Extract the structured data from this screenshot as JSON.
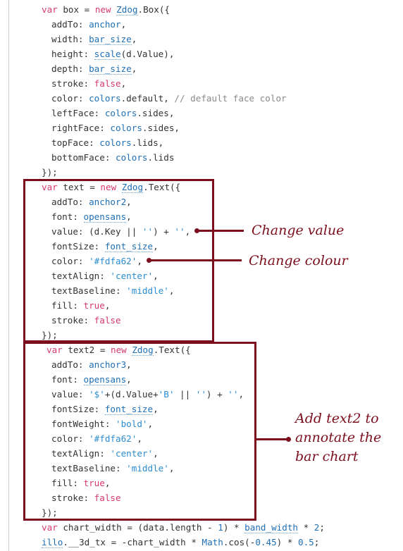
{
  "code": {
    "box_decl": {
      "kw_var": "var",
      "name": " box = ",
      "kw_new": "new",
      "sp": " ",
      "cls": "Zdog",
      "rest": ".Box({"
    },
    "box_props": [
      {
        "prop": "addTo: ",
        "val": "anchor",
        "tail": ","
      },
      {
        "prop": "width: ",
        "val": "bar_size",
        "tail": ","
      },
      {
        "prop": "height: ",
        "val": "scale",
        "mid": "(d.Value),"
      },
      {
        "prop": "depth: ",
        "val": "bar_size",
        "tail": ","
      },
      {
        "prop": "stroke: ",
        "val": "false",
        "tail": ","
      },
      {
        "prop": "color: ",
        "val": "colors",
        "mid": ".default, ",
        "comment": "// default face color"
      },
      {
        "prop": "leftFace: ",
        "val": "colors",
        "mid": ".sides,"
      },
      {
        "prop": "rightFace: ",
        "val": "colors",
        "mid": ".sides,"
      },
      {
        "prop": "topFace: ",
        "val": "colors",
        "mid": ".lids,"
      },
      {
        "prop": "bottomFace: ",
        "val": "colors",
        "mid": ".lids"
      }
    ],
    "close_1": "});",
    "text_decl": {
      "kw_var": "var",
      "name": " text = ",
      "kw_new": "new",
      "sp": " ",
      "cls": "Zdog",
      "rest": ".Text({"
    },
    "text_props": [
      {
        "prop": "addTo: ",
        "val": "anchor2",
        "tail": ","
      },
      {
        "prop": "font: ",
        "val": "opensans",
        "tail": ","
      },
      {
        "prop": "value: ",
        "a": "(d.Key || ",
        "s1": "''",
        "b": ") + ",
        "s2": "''",
        "c": ","
      },
      {
        "prop": "fontSize: ",
        "val": "font_size",
        "tail": ","
      },
      {
        "prop": "color: ",
        "str": "'#fdfa62'",
        "tail": ","
      },
      {
        "prop": "textAlign: ",
        "str": "'center'",
        "tail": ","
      },
      {
        "prop": "textBaseline: ",
        "str": "'middle'",
        "tail": ","
      },
      {
        "prop": "fill: ",
        "val": "true",
        "tail": ","
      },
      {
        "prop": "stroke: ",
        "val": "false",
        "tail": ""
      }
    ],
    "close_2": "});",
    "text2_decl": {
      "kw_var": "var",
      "name": " text2 = ",
      "kw_new": "new",
      "sp": " ",
      "cls": "Zdog",
      "rest": ".Text({"
    },
    "text2_props": [
      {
        "prop": "addTo: ",
        "val": "anchor3",
        "tail": ","
      },
      {
        "prop": "font: ",
        "val": "opensans",
        "tail": ","
      },
      {
        "prop": "value: ",
        "s0": "'$'",
        "a": "+(d.Value+",
        "s1": "'B'",
        "b": " || ",
        "s2": "''",
        "c": ") + ",
        "s3": "''",
        "d": ","
      },
      {
        "prop": "fontSize: ",
        "val": "font_size",
        "tail": ","
      },
      {
        "prop": "fontWeight: ",
        "str": "'bold'",
        "tail": ","
      },
      {
        "prop": "color: ",
        "str": "'#fdfa62'",
        "tail": ","
      },
      {
        "prop": "textAlign: ",
        "str": "'center'",
        "tail": ","
      },
      {
        "prop": "textBaseline: ",
        "str": "'middle'",
        "tail": ","
      },
      {
        "prop": "fill: ",
        "val": "true",
        "tail": ","
      },
      {
        "prop": "stroke: ",
        "val": "false",
        "tail": ""
      }
    ],
    "close_3": "});",
    "chart_width": {
      "kw_var": "var",
      "a": " chart_width = (data.length - ",
      "n1": "1",
      "b": ") * ",
      "ref": "band_width",
      "c": " * ",
      "n2": "2",
      "d": ";"
    },
    "illo": {
      "ref": "illo",
      "a": ".__3d_tx = -chart_width * ",
      "math": "Math",
      "b": ".cos(-",
      "n1": "0.45",
      "c": ") * ",
      "n2": "0.5",
      "d": ";"
    }
  },
  "annotations": {
    "change_value": "Change value",
    "change_colour": "Change colour",
    "add_text2": [
      "Add text2 to",
      "annotate the",
      "bar chart"
    ]
  },
  "colors": {
    "annotation": "#7b0f1e",
    "keyword": "#d73a6b",
    "reference": "#1f6fb5",
    "string": "#2a8dd1",
    "comment": "#8a8a8a"
  }
}
